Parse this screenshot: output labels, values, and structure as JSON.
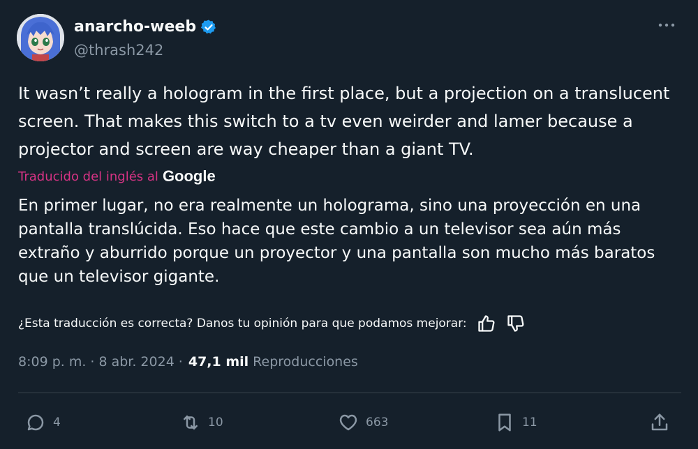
{
  "user": {
    "display_name": "anarcho-weeb",
    "handle": "@thrash242",
    "verified": true
  },
  "tweet": {
    "text": "It wasn’t really a hologram in the first place, but a projection on a translucent screen. That makes this switch to a tv even weirder and lamer because a projector and screen are way cheaper than a giant TV.",
    "translated_label": "Traducido del inglés al",
    "translator_brand": "Google",
    "translation": "En primer lugar, no era realmente un holograma, sino una proyección en una pantalla translúcida. Eso hace que este cambio a un televisor sea aún más extraño y aburrido porque un proyector y una pantalla son mucho más baratos que un televisor gigante.",
    "feedback_prompt": "¿Esta traducción es correcta? Danos tu opinión para que podamos mejorar:",
    "time": "8:09 p. m.",
    "separator": "·",
    "date": "8 abr. 2024",
    "views_count": "47,1 mil",
    "views_label": "Reproducciones"
  },
  "actions": {
    "replies": "4",
    "retweets": "10",
    "likes": "663",
    "bookmarks": "11"
  },
  "colors": {
    "background": "#15202b",
    "text": "#f7f9f9",
    "secondary": "#8b98a5",
    "verified": "#1d9bf0",
    "translated_label": "#d63384",
    "divider": "#38444d"
  },
  "icons": [
    "avatar",
    "verified-badge-icon",
    "more-options-icon",
    "thumbs-up-icon",
    "thumbs-down-icon",
    "reply-icon",
    "retweet-icon",
    "like-icon",
    "bookmark-icon",
    "share-icon"
  ]
}
